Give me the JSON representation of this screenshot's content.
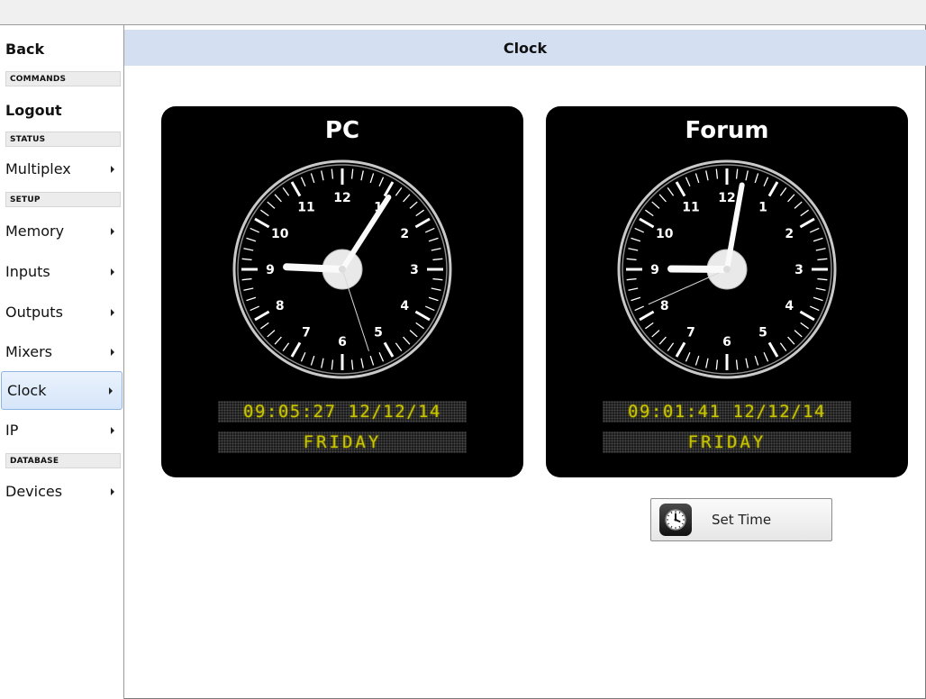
{
  "sidebar": {
    "back_label": "Back",
    "commands_header": "COMMANDS",
    "logout_label": "Logout",
    "status_header": "STATUS",
    "setup_header": "SETUP",
    "database_header": "DATABASE",
    "items": [
      {
        "label": "Multiplex"
      },
      {
        "label": "Memory"
      },
      {
        "label": "Inputs"
      },
      {
        "label": "Outputs"
      },
      {
        "label": "Mixers"
      },
      {
        "label": "Clock"
      },
      {
        "label": "IP"
      },
      {
        "label": "Devices"
      }
    ],
    "selected": "Clock"
  },
  "page": {
    "title": "Clock"
  },
  "clocks": [
    {
      "title": "PC",
      "time_text": "09:05:27 12/12/14",
      "day_text": "FRIDAY",
      "hands": {
        "hour": 9,
        "minute": 5,
        "second": 27
      }
    },
    {
      "title": "Forum",
      "time_text": "09:01:41 12/12/14",
      "day_text": "FRIDAY",
      "hands": {
        "hour": 9,
        "minute": 1,
        "second": 41
      }
    }
  ],
  "set_time": {
    "label": "Set Time",
    "icon": "clock-icon"
  },
  "colors": {
    "title_bar": "#d5dff2",
    "selected_item": "#d6e6fa",
    "led_text": "#c8c400",
    "panel_bg": "#000000"
  }
}
